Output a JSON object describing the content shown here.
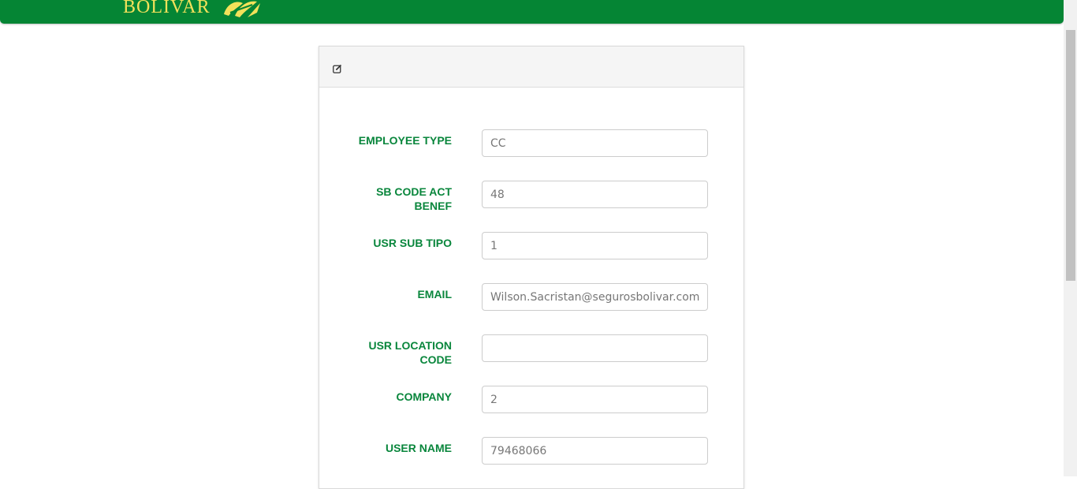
{
  "header": {
    "brand_text": "BOLIVAR",
    "bg_color": "#058534",
    "logo_color": "#f2e15a"
  },
  "panel": {
    "heading_icon": "edit-icon"
  },
  "form": {
    "label_color": "#09863c",
    "fields": [
      {
        "label": "EMPLOYEE TYPE",
        "value": "CC"
      },
      {
        "label": "SB CODE ACT BENEF",
        "value": "48"
      },
      {
        "label": "USR SUB TIPO",
        "value": "1"
      },
      {
        "label": "EMAIL",
        "value": "Wilson.Sacristan@segurosbolivar.com"
      },
      {
        "label": "USR LOCATION CODE",
        "value": ""
      },
      {
        "label": "COMPANY",
        "value": "2"
      },
      {
        "label": "USER NAME",
        "value": "79468066"
      }
    ]
  }
}
